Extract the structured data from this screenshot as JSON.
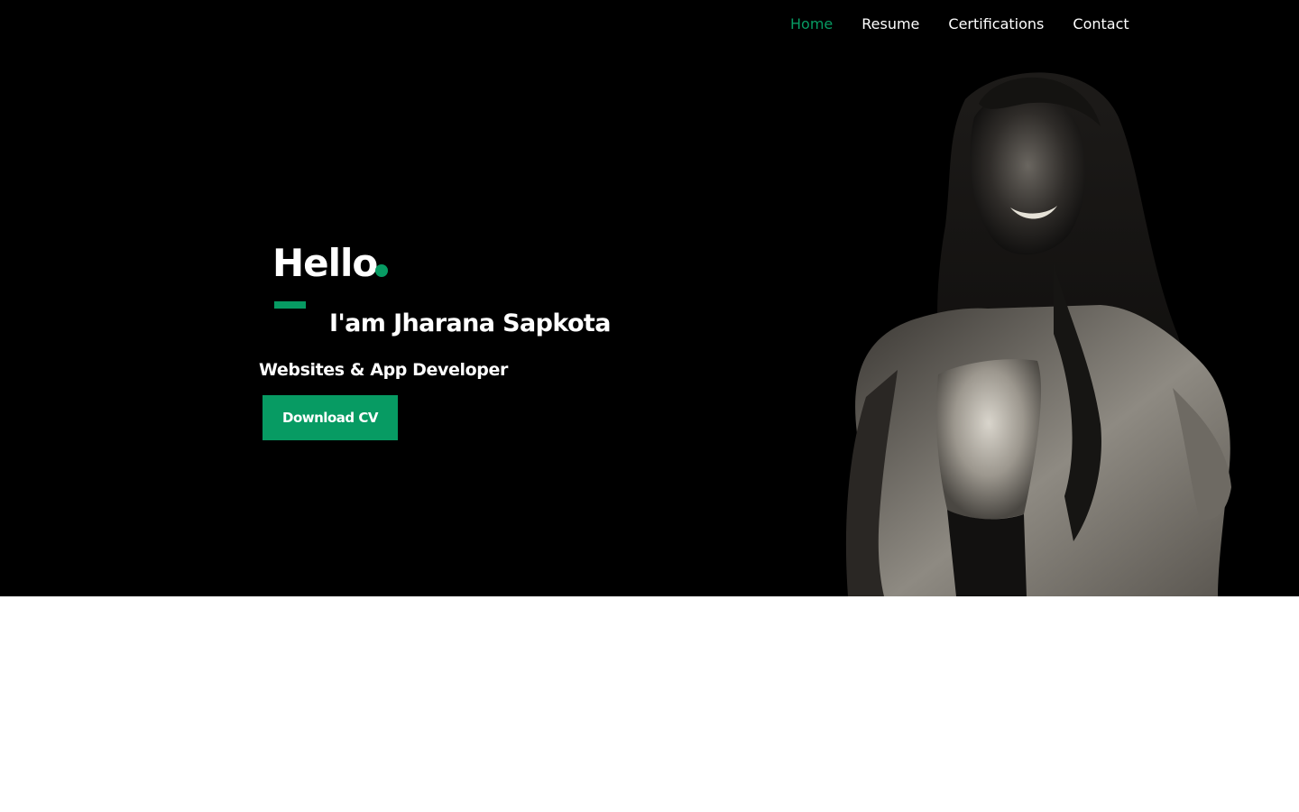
{
  "nav": {
    "items": [
      {
        "label": "Home",
        "active": true
      },
      {
        "label": "Resume",
        "active": false
      },
      {
        "label": "Certifications",
        "active": false
      },
      {
        "label": "Contact",
        "active": false
      }
    ]
  },
  "hero": {
    "greeting": "Hello",
    "name": "I'am Jharana Sapkota",
    "role": "Websites & App Developer",
    "cta_label": "Download CV"
  },
  "colors": {
    "accent": "#079b63",
    "hero_background": "#000000",
    "page_background": "#ffffff",
    "text": "#ffffff"
  }
}
